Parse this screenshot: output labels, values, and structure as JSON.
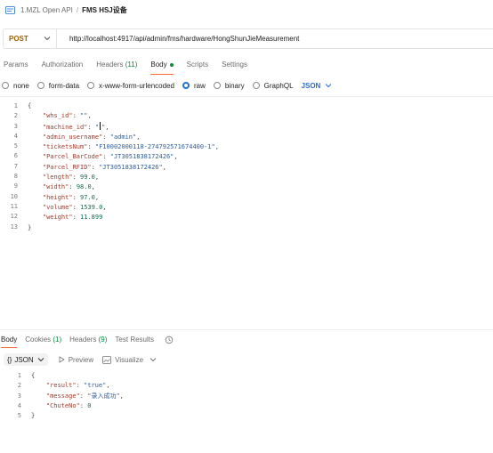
{
  "breadcrumb": {
    "collection": "1.MZL Open API",
    "separator": "/",
    "request_name": "FMS HSJ设备"
  },
  "request": {
    "method": "POST",
    "url": "http://localhost:4917/api/admin/fms/hardware/HongShunJieMeasurement"
  },
  "request_tabs": [
    {
      "label": "Params"
    },
    {
      "label": "Authorization"
    },
    {
      "label": "Headers",
      "count": "(11)"
    },
    {
      "label": "Body",
      "active": true
    },
    {
      "label": "Scripts"
    },
    {
      "label": "Settings"
    }
  ],
  "body_types": {
    "none": "none",
    "form_data": "form-data",
    "urlencoded": "x-www-form-urlencoded",
    "raw": "raw",
    "binary": "binary",
    "graphql": "GraphQL",
    "selected": "raw",
    "language": "JSON"
  },
  "request_body": {
    "line_numbers": [
      "1",
      "2",
      "3",
      "4",
      "5",
      "6",
      "7",
      "8",
      "9",
      "10",
      "11",
      "12",
      "13"
    ],
    "open_brace": "{",
    "close_brace": "}",
    "fields": [
      {
        "key": "\"whs_id\"",
        "value": "\"\"",
        "type": "str"
      },
      {
        "key": "\"machine_id\"",
        "value": "\"\"",
        "type": "str",
        "cursor": true
      },
      {
        "key": "\"admin_username\"",
        "value": "\"admin\"",
        "type": "str"
      },
      {
        "key": "\"ticketsNum\"",
        "value": "\"F10002000118-274792571674400-1\"",
        "type": "str"
      },
      {
        "key": "\"Parcel_BarCode\"",
        "value": "\"JT3051838172426\"",
        "type": "str"
      },
      {
        "key": "\"Parcel_RFID\"",
        "value": "\"JT3051838172426\"",
        "type": "str"
      },
      {
        "key": "\"length\"",
        "value": "99.0",
        "type": "num"
      },
      {
        "key": "\"width\"",
        "value": "98.0",
        "type": "num"
      },
      {
        "key": "\"height\"",
        "value": "97.0",
        "type": "num"
      },
      {
        "key": "\"volume\"",
        "value": "1539.0",
        "type": "num"
      },
      {
        "key": "\"weight\"",
        "value": "11.899",
        "type": "num",
        "last": true
      }
    ]
  },
  "response_tabs": [
    {
      "label": "Body",
      "active": true
    },
    {
      "label": "Cookies",
      "count": "(1)"
    },
    {
      "label": "Headers",
      "count": "(9)"
    },
    {
      "label": "Test Results"
    }
  ],
  "response_toolbar": {
    "format_label": "JSON",
    "preview": "Preview",
    "visualize": "Visualize"
  },
  "response_body": {
    "line_numbers": [
      "1",
      "2",
      "3",
      "4",
      "5"
    ],
    "open_brace": "{",
    "close_brace": "}",
    "fields": [
      {
        "key": "\"result\"",
        "value": "\"true\"",
        "type": "str"
      },
      {
        "key": "\"message\"",
        "value": "\"录入成功\"",
        "type": "str"
      },
      {
        "key": "\"ChuteNo\"",
        "value": "0",
        "type": "num",
        "last": true
      }
    ]
  },
  "colors": {
    "accent": "#ff6c37",
    "method_post": "#a0600a",
    "link_blue": "#1f6fd6",
    "count_green": "#0a8a3f"
  }
}
